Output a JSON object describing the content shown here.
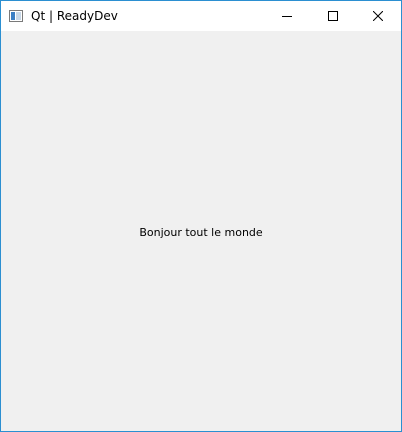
{
  "window": {
    "title": "Qt | ReadyDev",
    "controls": [
      "minimize-icon",
      "maximize-icon",
      "close-icon"
    ]
  },
  "content": {
    "label": "Bonjour tout le monde"
  },
  "colors": {
    "border": "#2b8fd1",
    "client_background": "#f0f0f0",
    "titlebar_background": "#ffffff"
  }
}
